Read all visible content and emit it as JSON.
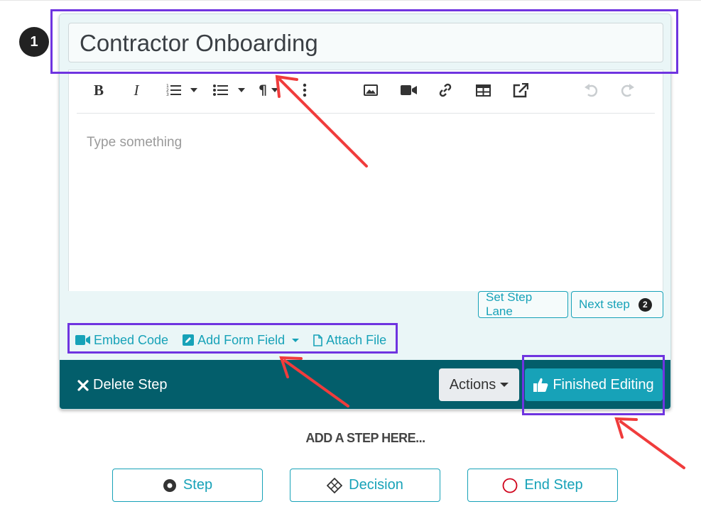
{
  "step": {
    "number": "1",
    "title": "Contractor Onboarding",
    "editor_placeholder": "Type something"
  },
  "toolbar": {
    "items": [
      "bold-icon",
      "italic-icon",
      "ordered-list-icon",
      "unordered-list-icon",
      "paragraph-icon",
      "more-icon",
      "image-icon",
      "video-icon",
      "link-icon",
      "table-icon",
      "external-link-icon",
      "undo-icon",
      "redo-icon"
    ],
    "bold_label": "B",
    "italic_label": "I",
    "paragraph_label": "¶"
  },
  "step_buttons": {
    "set_step_lane": "Set Step Lane",
    "next_step": "Next step",
    "next_step_badge": "2"
  },
  "field_actions": {
    "embed_code": "Embed Code",
    "add_form_field": "Add Form Field",
    "attach_file": "Attach File"
  },
  "footer": {
    "delete_step": "Delete Step",
    "actions": "Actions",
    "finished_editing": "Finished Editing"
  },
  "add_step": {
    "label": "ADD A STEP HERE...",
    "step": "Step",
    "decision": "Decision",
    "end_step": "End Step"
  },
  "colors": {
    "accent": "#17a2b8",
    "footer_bg": "#035e6b",
    "highlight": "#6f34e0",
    "arrow": "#f03c3c"
  }
}
